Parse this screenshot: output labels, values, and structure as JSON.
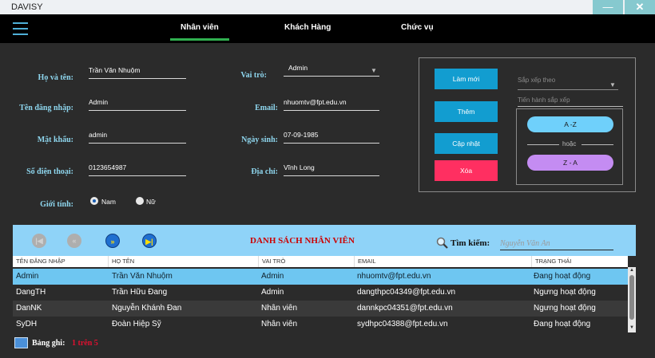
{
  "window": {
    "title": "DAVISY",
    "minimize": "—",
    "close": "✕"
  },
  "nav": {
    "tabs": [
      "Nhân viên",
      "Khách Hàng",
      "Chức vụ"
    ],
    "active_tab": "Nhân viên",
    "accent": "#30b050"
  },
  "form": {
    "fullname_label": "Họ và tên:",
    "fullname": "Trần Văn Nhuộm",
    "username_label": "Tên đăng nhập:",
    "username": "Admin",
    "password_label": "Mật khẩu:",
    "password": "admin",
    "phone_label": "Số điện thoại:",
    "phone": "0123654987",
    "gender_label": "Giới tính:",
    "gender_male": "Nam",
    "gender_female": "Nữ",
    "gender_selected": "Nam",
    "role_label": "Vai trò:",
    "role": "Admin",
    "email_label": "Email:",
    "email": "nhuomtv@fpt.edu.vn",
    "birthday_label": "Ngày sinh:",
    "birthday": "07-09-1985",
    "address_label": "Địa chỉ:",
    "address": "Vĩnh Long"
  },
  "actions": {
    "refresh": "Làm mới",
    "add": "Thêm",
    "update": "Cập nhật",
    "delete": "Xóa",
    "sort_by_placeholder": "Sắp xếp theo",
    "sort_do_label": "Tiến hành sắp xếp",
    "sort_az": "A -Z",
    "or": "hoặc",
    "sort_za": "Z - A",
    "colors": {
      "primary": "#129dd0",
      "danger": "#ff2f61",
      "az": "#6fd0fb",
      "za": "#c48cf2"
    }
  },
  "list": {
    "title": "DANH SÁCH NHÂN VIÊN",
    "search_label": "Tìm kiếm:",
    "search_placeholder": "Nguyễn Văn An",
    "nav_buttons": [
      "first",
      "prev",
      "next",
      "last"
    ],
    "columns": [
      "TÊN ĐĂNG NHẬP",
      "HỌ TÊN",
      "VAI TRÒ",
      "EMAIL",
      "TRẠNG THÁI"
    ],
    "rows": [
      [
        "Admin",
        "Trần Văn Nhuộm",
        "Admin",
        "nhuomtv@fpt.edu.vn",
        "Đang hoạt động"
      ],
      [
        "DangTH",
        "Trần Hữu Đang",
        "Admin",
        "dangthpc04349@fpt.edu.vn",
        "Ngưng hoạt động"
      ],
      [
        "DanNK",
        "Nguyễn Khánh Đan",
        "Nhân viên",
        "dannkpc04351@fpt.edu.vn",
        "Ngưng hoạt động"
      ],
      [
        "SyDH",
        "Đoàn Hiệp Sỹ",
        "Nhân viên",
        "sydhpc04388@fpt.edu.vn",
        "Đang hoạt động"
      ]
    ],
    "selected_row": 0
  },
  "footer": {
    "records_label": "Bảng ghi:",
    "records_value": "1 trên 5"
  }
}
